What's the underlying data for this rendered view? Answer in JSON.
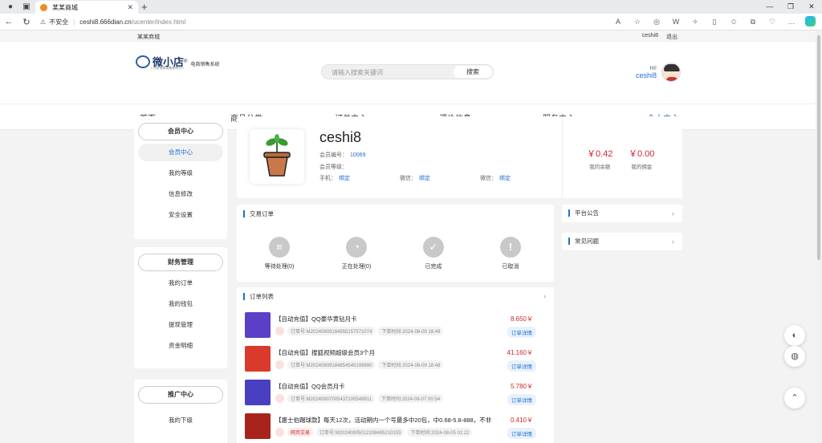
{
  "browser": {
    "tab_title": "某某商城",
    "url_warning": "不安全",
    "url_host": "ceshi8.666dian.cn",
    "url_path": "/ucenter/index.html"
  },
  "topbar": {
    "site_name": "某某商城",
    "username": "ceshi8",
    "logout": "退出"
  },
  "header": {
    "logo_name": "微小店",
    "logo_reg": "®",
    "logo_sub": "电商销售系统",
    "logo_tiny": "• 开启电商销售新时代 •",
    "search_placeholder": "请输入搜索关键词",
    "search_button": "搜索",
    "greeting": "Hi!",
    "username": "ceshi8"
  },
  "menu": [
    "首页",
    "商品分类",
    "订单中心",
    "调价信息",
    "服务中心",
    "个人中心"
  ],
  "sidebar": {
    "member": {
      "title": "会员中心",
      "items": [
        "会员中心",
        "我的等级",
        "信息修改",
        "安全设置"
      ]
    },
    "finance": {
      "title": "财务管理",
      "items": [
        "我的订单",
        "我的钱包",
        "提现管理",
        "资金明细"
      ]
    },
    "promo": {
      "title": "推广中心",
      "items": [
        "我的下级"
      ]
    }
  },
  "profile": {
    "username": "ceshi8",
    "member_no_label": "会员编号：",
    "member_no": "10069",
    "level_label": "会员等级：",
    "phone_label": "手机：",
    "phone_bind": "绑定",
    "wechat_label": "微信：",
    "wechat_bind": "绑定",
    "wechat2_label": "微信：",
    "wechat2_bind": "绑定"
  },
  "balance": {
    "amount": "￥0.42",
    "amount_label": "我的余额",
    "commission": "￥0.00",
    "commission_label": "我的佣金"
  },
  "trade": {
    "title": "交易订单",
    "stats": [
      {
        "label": "等待处理(0)",
        "icon": "document-icon",
        "glyph": "≡"
      },
      {
        "label": "正在处理(0)",
        "icon": "clock-icon",
        "glyph": "◔"
      },
      {
        "label": "已完成",
        "icon": "check-icon",
        "glyph": "✓"
      },
      {
        "label": "已取消",
        "icon": "exclamation-icon",
        "glyph": "!"
      }
    ]
  },
  "order_list": {
    "title": "订单列表",
    "order_no_label": "订单号:",
    "time_label": "下单时间:",
    "detail_label": "订单详情",
    "orders": [
      {
        "title": "【自动充值】QQ豪华黄钻月卡",
        "price": "8.650￥",
        "no": "M20240809184955157571074",
        "time": "2024-08-09 18:49",
        "thumb_color": "#5b3fc7"
      },
      {
        "title": "【自动充值】搜狐视频超级会员3个月",
        "price": "41.160￥",
        "no": "M20240809184854545199890",
        "time": "2024-08-09 18:48",
        "thumb_color": "#d93a2b"
      },
      {
        "title": "【自动充值】QQ会员月卡",
        "price": "5.780￥",
        "no": "M20240807005437100549911",
        "time": "2024-08-07 00:54",
        "thumb_color": "#4a3fc0"
      },
      {
        "title": "【惠士伯踢球款】每天12次，活动期内一个号最多中20包，中0.68-5.8-888，不非...",
        "price": "0.410￥",
        "no": "M20240805012208485210153",
        "time": "2024-08-05 01:22",
        "tag": "网页交易",
        "thumb_color": "#a8231c"
      }
    ]
  },
  "right_panels": {
    "notice": "平台公告",
    "faq": "常见问题"
  },
  "colors": {
    "accent": "#1e6fd0",
    "price": "#d0262b"
  }
}
